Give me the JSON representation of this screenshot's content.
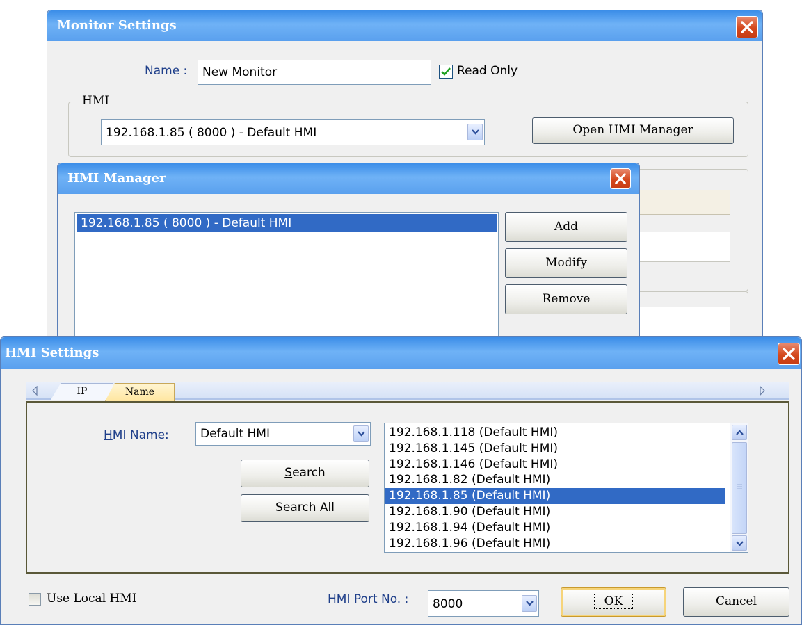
{
  "monitor": {
    "title": "Monitor Settings",
    "name_label": "Name :",
    "name_value": "New Monitor",
    "read_only_label": "Read Only",
    "read_only_checked": true,
    "hmi_group_label": "HMI",
    "hmi_selected": "192.168.1.85 ( 8000 )  - Default HMI",
    "open_manager_label": "Open HMI Manager"
  },
  "manager": {
    "title": "HMI Manager",
    "items": [
      "192.168.1.85 ( 8000 )  - Default HMI"
    ],
    "add_label": "Add",
    "modify_label": "Modify",
    "remove_label": "Remove"
  },
  "settings": {
    "title": "HMI Settings",
    "tabs": [
      "IP",
      "Name"
    ],
    "active_tab": "Name",
    "hmi_name_label": "HMI Name:",
    "hmi_name_value": "Default HMI",
    "search_label": "Search",
    "search_all_label": "Search All",
    "results": [
      "192.168.1.118 (Default HMI)",
      "192.168.1.145 (Default HMI)",
      "192.168.1.146 (Default HMI)",
      "192.168.1.82 (Default HMI)",
      "192.168.1.85 (Default HMI)",
      "192.168.1.90 (Default HMI)",
      "192.168.1.94 (Default HMI)",
      "192.168.1.96 (Default HMI)"
    ],
    "selected_result": "192.168.1.85 (Default HMI)",
    "use_local_label": "Use Local HMI",
    "use_local_checked": false,
    "port_label": "HMI Port No. :",
    "port_value": "8000",
    "ok_label": "OK",
    "cancel_label": "Cancel"
  },
  "colors": {
    "titlebar": "#4a97ec",
    "selection": "#316ac5",
    "close": "#d4481d",
    "tab_active": "#ffe9a8"
  }
}
